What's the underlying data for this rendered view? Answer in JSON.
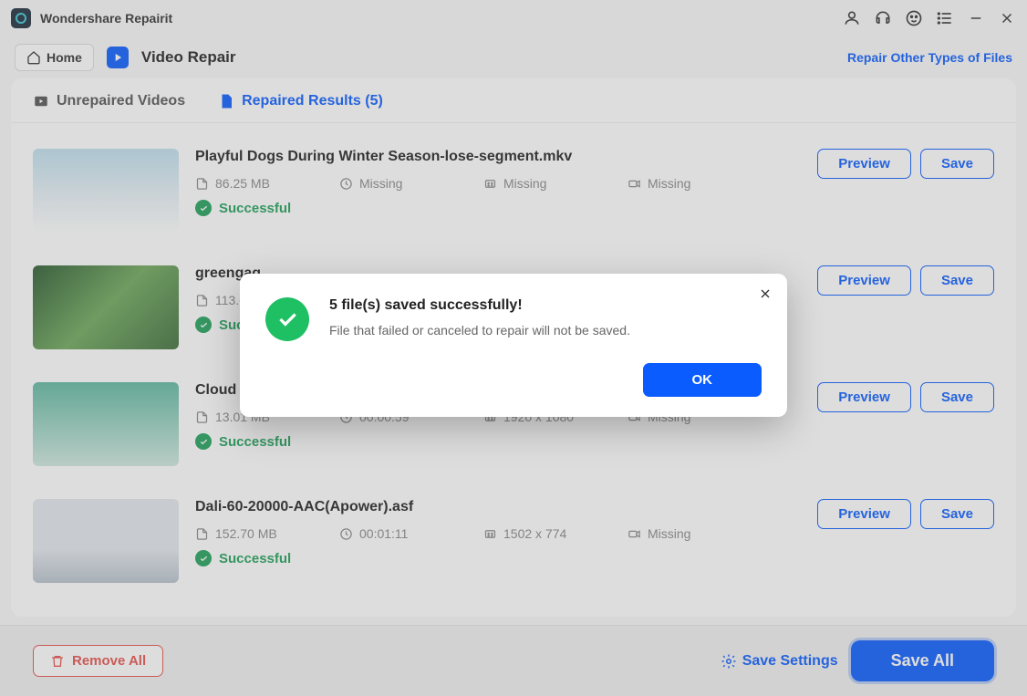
{
  "app": {
    "title": "Wondershare Repairit"
  },
  "topbar": {
    "home_label": "Home",
    "module_title": "Video Repair",
    "repair_other_label": "Repair Other Types of Files"
  },
  "tabs": {
    "unrepaired_label": "Unrepaired Videos",
    "repaired_label": "Repaired Results (5)"
  },
  "actions": {
    "preview_label": "Preview",
    "save_label": "Save",
    "status_success": "Successful"
  },
  "files": [
    {
      "title": "Playful Dogs During Winter Season-lose-segment.mkv",
      "size": "86.25 MB",
      "duration": "Missing",
      "resolution": "Missing",
      "camera": "Missing",
      "thumb": "winter"
    },
    {
      "title": "greengag",
      "size": "113.06",
      "duration": "",
      "resolution": "",
      "camera": "",
      "thumb": "green",
      "status_trunc": "Succ"
    },
    {
      "title": "Cloud Formation video.avi",
      "size": "13.01 MB",
      "duration": "00:00:59",
      "resolution": "1920 x 1080",
      "camera": "Missing",
      "thumb": "sky"
    },
    {
      "title": "Dali-60-20000-AAC(Apower).asf",
      "size": "152.70 MB",
      "duration": "00:01:11",
      "resolution": "1502 x 774",
      "camera": "Missing",
      "thumb": "city"
    }
  ],
  "footer": {
    "remove_all_label": "Remove All",
    "save_settings_label": "Save Settings",
    "save_all_label": "Save All"
  },
  "modal": {
    "title": "5 file(s) saved successfully!",
    "subtitle": "File that failed or canceled to repair will not be saved.",
    "ok_label": "OK"
  }
}
